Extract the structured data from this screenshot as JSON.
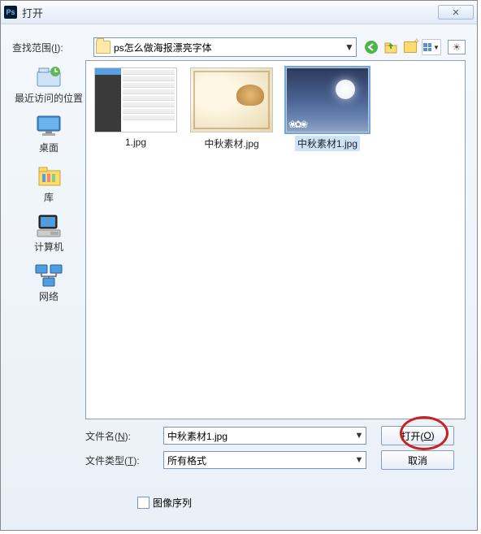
{
  "titlebar": {
    "app_icon_text": "Ps",
    "title": "打开",
    "close_symbol": "✕"
  },
  "lookin": {
    "label_prefix": "查找范围(",
    "label_hotkey": "I",
    "label_suffix": "):",
    "folder_name": "ps怎么做海报漂亮字体",
    "pin_symbol": "☀"
  },
  "places": {
    "recent": "最近访问的位置",
    "desktop": "桌面",
    "libraries": "库",
    "computer": "计算机",
    "network": "网络"
  },
  "files": {
    "item1": "1.jpg",
    "item2": "中秋素材.jpg",
    "item3": "中秋素材1.jpg"
  },
  "form": {
    "filename_label_prefix": "文件名(",
    "filename_hotkey": "N",
    "filename_label_suffix": "):",
    "filename_value": "中秋素材1.jpg",
    "filetype_label_prefix": "文件类型(",
    "filetype_hotkey": "T",
    "filetype_label_suffix": "):",
    "filetype_value": "所有格式"
  },
  "buttons": {
    "open_prefix": "打开(",
    "open_hotkey": "O",
    "open_suffix": ")",
    "cancel": "取消"
  },
  "checkbox": {
    "label": "图像序列"
  }
}
